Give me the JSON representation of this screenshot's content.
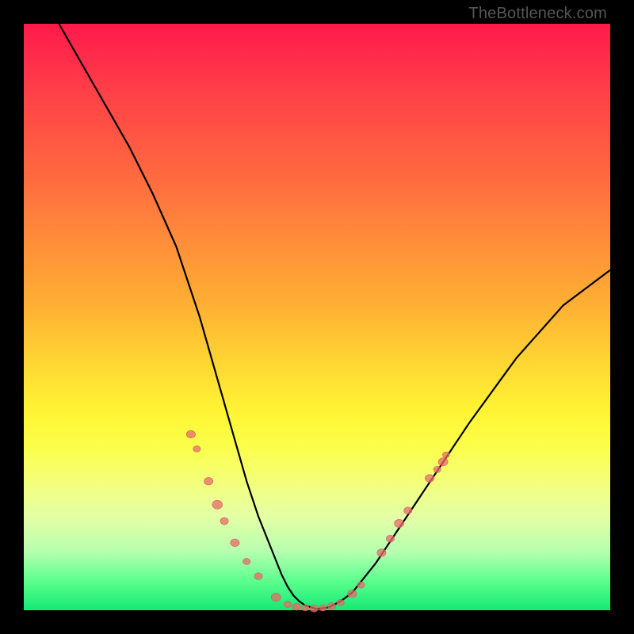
{
  "watermark": "TheBottleneck.com",
  "colors": {
    "gradient_top": "#ff1a4a",
    "gradient_mid": "#fff433",
    "gradient_bottom": "#16e873",
    "curve": "#000000",
    "marker": "#e56b6b",
    "frame": "#000000"
  },
  "chart_data": {
    "type": "line",
    "title": "",
    "xlabel": "",
    "ylabel": "",
    "xlim": [
      0,
      100
    ],
    "ylim": [
      0,
      100
    ],
    "grid": false,
    "legend": false,
    "annotations": [
      {
        "text": "TheBottleneck.com",
        "position": "top-right"
      }
    ],
    "series": [
      {
        "name": "bottleneck-curve",
        "x": [
          6,
          10,
          14,
          18,
          22,
          26,
          28,
          30,
          32,
          34,
          36,
          38,
          40,
          42,
          44,
          45,
          46,
          47,
          48,
          50,
          52,
          54,
          56,
          60,
          64,
          70,
          76,
          84,
          92,
          100
        ],
        "y": [
          100,
          93,
          86,
          79,
          71,
          62,
          56,
          50,
          43,
          36,
          29,
          22,
          16,
          11,
          6,
          4,
          2.5,
          1.5,
          0.8,
          0.2,
          0.5,
          1.5,
          3,
          8,
          14,
          23,
          32,
          43,
          52,
          58
        ],
        "comment": "y is percent of plot height from bottom; V-shaped bottleneck curve with minimum ≈ x 50"
      }
    ],
    "markers": [
      {
        "x": 28.5,
        "y": 30,
        "r": 1.3
      },
      {
        "x": 29.5,
        "y": 27.5,
        "r": 1.1
      },
      {
        "x": 31.5,
        "y": 22,
        "r": 1.3
      },
      {
        "x": 33,
        "y": 18,
        "r": 1.5
      },
      {
        "x": 34.2,
        "y": 15.2,
        "r": 1.2
      },
      {
        "x": 36,
        "y": 11.5,
        "r": 1.3
      },
      {
        "x": 38,
        "y": 8.3,
        "r": 1.1
      },
      {
        "x": 40,
        "y": 5.8,
        "r": 1.2
      },
      {
        "x": 43,
        "y": 2.2,
        "r": 1.4
      },
      {
        "x": 45,
        "y": 1,
        "r": 1.1
      },
      {
        "x": 46.5,
        "y": 0.6,
        "r": 1.2
      },
      {
        "x": 48,
        "y": 0.4,
        "r": 1.1
      },
      {
        "x": 49.5,
        "y": 0.3,
        "r": 1.2
      },
      {
        "x": 51,
        "y": 0.4,
        "r": 1.1
      },
      {
        "x": 52.5,
        "y": 0.7,
        "r": 1.2
      },
      {
        "x": 54,
        "y": 1.3,
        "r": 1.1
      },
      {
        "x": 56,
        "y": 2.8,
        "r": 1.3
      },
      {
        "x": 57.5,
        "y": 4.3,
        "r": 1.1
      },
      {
        "x": 61,
        "y": 9.8,
        "r": 1.3
      },
      {
        "x": 62.5,
        "y": 12.2,
        "r": 1.2
      },
      {
        "x": 64,
        "y": 14.8,
        "r": 1.4
      },
      {
        "x": 65.5,
        "y": 17,
        "r": 1.2
      },
      {
        "x": 69.2,
        "y": 22.5,
        "r": 1.3
      },
      {
        "x": 70.5,
        "y": 24,
        "r": 1.1
      },
      {
        "x": 71.5,
        "y": 25.3,
        "r": 1.4
      },
      {
        "x": 72,
        "y": 26.5,
        "r": 1.0
      }
    ]
  }
}
